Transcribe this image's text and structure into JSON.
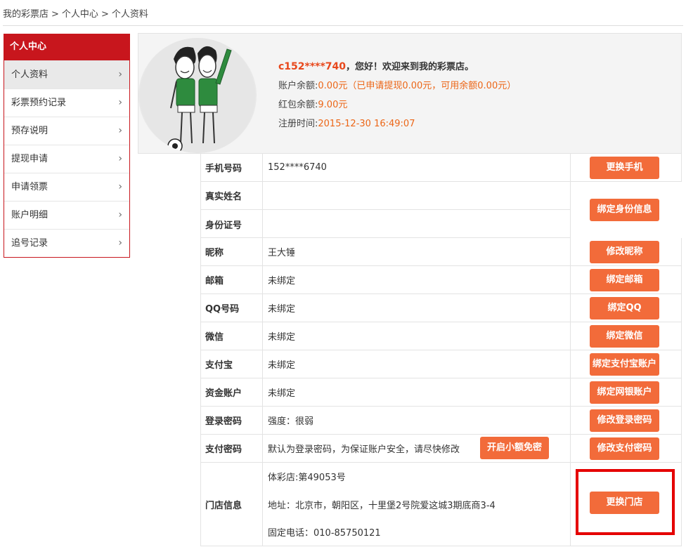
{
  "breadcrumb": [
    "我的彩票店",
    "个人中心",
    "个人资料"
  ],
  "sidebar": {
    "title": "个人中心",
    "items": [
      {
        "label": "个人资料",
        "active": true
      },
      {
        "label": "彩票预约记录"
      },
      {
        "label": "预存说明"
      },
      {
        "label": "提现申请"
      },
      {
        "label": "申请领票"
      },
      {
        "label": "账户明细"
      },
      {
        "label": "追号记录"
      }
    ],
    "chevron": "›"
  },
  "profile": {
    "username": "c152****740",
    "greeting": "，您好！欢迎来到我的彩票店。",
    "balance_label": "账户余额:",
    "balance_value": "0.00元（已申请提现0.00元，可用余额0.00元）",
    "redpacket_label": "红包余额:",
    "redpacket_value": "9.00元",
    "register_label": "注册时间:",
    "register_value": "2015-12-30 16:49:07"
  },
  "rows": {
    "phone": {
      "label": "手机号码",
      "value": "152****6740",
      "button": "更换手机"
    },
    "realname": {
      "label": "真实姓名",
      "value": ""
    },
    "idcard": {
      "label": "身份证号",
      "value": "",
      "button": "绑定身份信息"
    },
    "nickname": {
      "label": "昵称",
      "value": "王大锤",
      "button": "修改昵称"
    },
    "email": {
      "label": "邮箱",
      "value": "未绑定",
      "button": "绑定邮箱"
    },
    "qq": {
      "label": "QQ号码",
      "value": "未绑定",
      "button": "绑定QQ"
    },
    "wechat": {
      "label": "微信",
      "value": "未绑定",
      "button": "绑定微信"
    },
    "alipay": {
      "label": "支付宝",
      "value": "未绑定",
      "button": "绑定支付宝账户"
    },
    "fund": {
      "label": "资金账户",
      "value": "未绑定",
      "button": "绑定网银账户"
    },
    "loginpwd": {
      "label": "登录密码",
      "value": "强度：很弱",
      "button": "修改登录密码"
    },
    "paypwd": {
      "label": "支付密码",
      "value": "默认为登录密码，为保证账户安全，请尽快修改",
      "extra_button": "开启小额免密",
      "button": "修改支付密码"
    },
    "store": {
      "label": "门店信息",
      "line1": "体彩店:第49053号",
      "line2": "地址：北京市，朝阳区，十里堡2号院爱这城3期底商3-4",
      "line3": "固定电话：010-85750121",
      "button": "更换门店"
    }
  },
  "colors": {
    "brand_red": "#c8161d",
    "button_orange": "#f26b3a",
    "value_orange": "#ec6617",
    "highlight_red": "#e50000"
  }
}
